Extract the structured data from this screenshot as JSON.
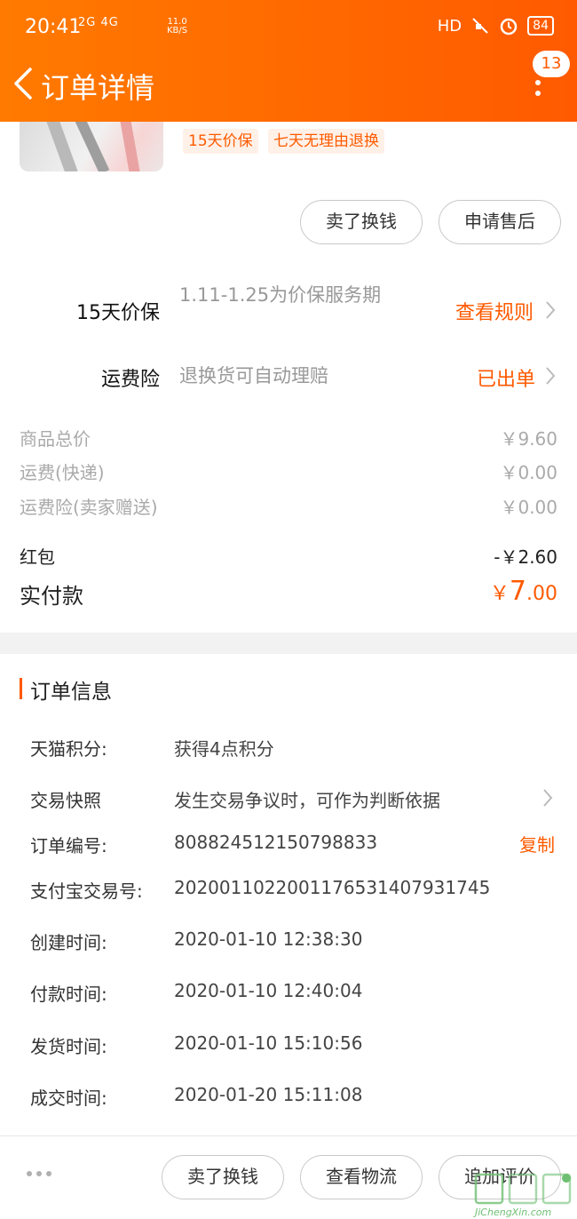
{
  "status_bar": {
    "time": "20:41",
    "signal": "2G 4G",
    "speed_value": "11.0",
    "speed_unit": "KB/S",
    "hd": "HD",
    "battery": "84"
  },
  "nav": {
    "title": "订单详情",
    "badge": "13"
  },
  "product": {
    "tags": [
      "15天价保",
      "七天无理由退换"
    ]
  },
  "actions_top": {
    "sell": "卖了换钱",
    "after_sale": "申请售后"
  },
  "services": [
    {
      "label": "15天价保",
      "desc": "1.11-1.25为价保服务期",
      "link": "查看规则"
    },
    {
      "label": "运费险",
      "desc": "退换货可自动理赔",
      "link": "已出单"
    }
  ],
  "prices": {
    "goods_total_label": "商品总价",
    "goods_total": "￥9.60",
    "shipping_label": "运费(快递)",
    "shipping": "￥0.00",
    "insurance_label": "运费险(卖家赠送)",
    "insurance": "￥0.00",
    "redpack_label": "红包",
    "redpack": "-￥2.60",
    "paid_label": "实付款",
    "paid_symbol": "￥",
    "paid_int": "7",
    "paid_dec": ".00"
  },
  "order_info": {
    "title": "订单信息",
    "rows": [
      {
        "key": "天猫积分:",
        "value": "获得4点积分"
      },
      {
        "key": "交易快照",
        "value": "发生交易争议时，可作为判断依据"
      },
      {
        "key": "订单编号:",
        "value": "808824512150798833",
        "action": "复制"
      },
      {
        "key": "支付宝交易号:",
        "value": "2020011022001176531407931745"
      },
      {
        "key": "创建时间:",
        "value": "2020-01-10 12:38:30"
      },
      {
        "key": "付款时间:",
        "value": "2020-01-10 12:40:04"
      },
      {
        "key": "发货时间:",
        "value": "2020-01-10 15:10:56"
      },
      {
        "key": "成交时间:",
        "value": "2020-01-20 15:11:08"
      }
    ]
  },
  "actions_bottom": {
    "sell": "卖了换钱",
    "logistics": "查看物流",
    "review": "追加评价"
  },
  "watermark": "JiChengXin.com",
  "colors": {
    "accent": "#ff5a00",
    "muted": "#999999"
  }
}
